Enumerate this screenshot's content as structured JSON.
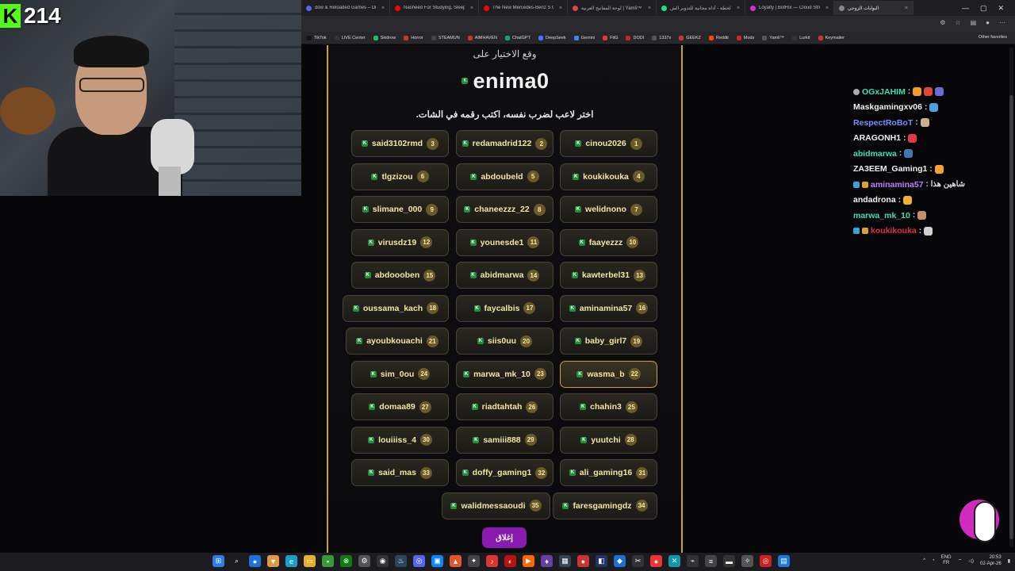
{
  "browser": {
    "tabs": [
      {
        "label": "dow & Reloaded Games – Dr",
        "color": "#5865f2"
      },
      {
        "label": "Nasheed For Studying, Sleep",
        "color": "#ff0000"
      },
      {
        "label": "The New Mercedes-Benz S Cl",
        "color": "#ff0000"
      },
      {
        "label": "لوحة المفاتيح العربية | Yamli™ محرر",
        "color": "#d44"
      },
      {
        "label": "تجنبوا الخطة - أداة مجانية للتدوير الش",
        "color": "#2d8"
      },
      {
        "label": "Loyalty | BotRix — Cloud Stream",
        "color": "#c3c"
      },
      {
        "label": "البوابات الزوجي",
        "color": "#888"
      }
    ],
    "window_controls": [
      "—",
      "▢",
      "✕"
    ],
    "bookmarks": [
      "TikTok",
      "LIVE Center",
      "Skidrow",
      "Horror",
      "STEAMUN",
      "AIMHAVEN",
      "ChatGPT",
      "DeepSeek",
      "Gemini",
      "FitG",
      "DODI",
      "1337x",
      "GEEKZ",
      "Reddit",
      "Mods",
      "Yamli™",
      "Lurkit",
      "Keymailer"
    ],
    "other_favorites": "Other favorites"
  },
  "webcam": {
    "viewer_count": "214",
    "platform_icon": "kick-icon"
  },
  "giveaway": {
    "selection_label": "وقع الاختيار على",
    "winner_name": "enima0",
    "instruction": "اختر لاعب لضرب نفسه، اكتب رقمه في الشات.",
    "close_label": "إغلاق",
    "players": [
      {
        "num": "1",
        "name": "cinou2026"
      },
      {
        "num": "2",
        "name": "redamadrid122"
      },
      {
        "num": "3",
        "name": "said3102rmd"
      },
      {
        "num": "4",
        "name": "koukikouka"
      },
      {
        "num": "5",
        "name": "abdoubeld"
      },
      {
        "num": "6",
        "name": "tlgzizou"
      },
      {
        "num": "7",
        "name": "welidnono"
      },
      {
        "num": "8",
        "name": "chaneezzz_22"
      },
      {
        "num": "9",
        "name": "slimane_000"
      },
      {
        "num": "10",
        "name": "faayezzz"
      },
      {
        "num": "11",
        "name": "younesde1"
      },
      {
        "num": "12",
        "name": "virusdz19"
      },
      {
        "num": "13",
        "name": "kawterbel31"
      },
      {
        "num": "14",
        "name": "abidmarwa"
      },
      {
        "num": "15",
        "name": "abdoooben"
      },
      {
        "num": "16",
        "name": "aminamina57"
      },
      {
        "num": "17",
        "name": "faycalbis"
      },
      {
        "num": "18",
        "name": "oussama_kach"
      },
      {
        "num": "19",
        "name": "baby_girl7"
      },
      {
        "num": "20",
        "name": "siis0uu"
      },
      {
        "num": "21",
        "name": "ayoubkouachi"
      },
      {
        "num": "22",
        "name": "wasma_b"
      },
      {
        "num": "23",
        "name": "marwa_mk_10"
      },
      {
        "num": "24",
        "name": "sim_0ou"
      },
      {
        "num": "25",
        "name": "chahin3"
      },
      {
        "num": "26",
        "name": "riadtahtah"
      },
      {
        "num": "27",
        "name": "domaa89"
      },
      {
        "num": "28",
        "name": "yuutchi"
      },
      {
        "num": "29",
        "name": "samiii888"
      },
      {
        "num": "30",
        "name": "louiiiss_4"
      },
      {
        "num": "31",
        "name": "ali_gaming16"
      },
      {
        "num": "32",
        "name": "doffy_gaming1"
      },
      {
        "num": "33",
        "name": "said_mas"
      },
      {
        "num": "34",
        "name": "faresgamingdz"
      },
      {
        "num": "35",
        "name": "walidmessaoudi"
      }
    ]
  },
  "chat": [
    {
      "user": "OGxJAHIM",
      "color": "#3ee0b0",
      "msg": ":",
      "emotes": [
        "#f59b2c",
        "#e0453a",
        "#6b6bd6"
      ]
    },
    {
      "user": "Maskgamingxv06",
      "color": "#f0f0f0",
      "msg": ":",
      "emotes": [
        "#4aa0e0"
      ]
    },
    {
      "user": "RespectRoBoT",
      "color": "#7a8cff",
      "msg": ":",
      "emotes": [
        "#c9b090"
      ]
    },
    {
      "user": "ARAGONH1",
      "color": "#f0f0f0",
      "msg": ":",
      "emotes": [
        "#e03a4a"
      ]
    },
    {
      "user": "abidmarwa",
      "color": "#3ee0b0",
      "msg": ":",
      "emotes": [
        "#3a7ab0"
      ]
    },
    {
      "user": "ZA3EEM_Gaming1",
      "color": "#f0f0f0",
      "msg": ":",
      "emotes": [
        "#f5a030"
      ]
    },
    {
      "user": "aminamina57",
      "color": "#c080ff",
      "msg": ": شاهين هذا",
      "emotes": []
    },
    {
      "user": "andadrona",
      "color": "#f0f0f0",
      "msg": ":",
      "emotes": [
        "#f0b030"
      ]
    },
    {
      "user": "marwa_mk_10",
      "color": "#3ee0b0",
      "msg": ":",
      "emotes": [
        "#c09070"
      ]
    },
    {
      "user": "koukikouka",
      "color": "#e03040",
      "msg": ":",
      "emotes": [
        "#d0d0d0"
      ]
    }
  ],
  "taskbar": {
    "lang": "ENG",
    "region": "FR",
    "time": "20:53",
    "date": "02-Apr-26"
  }
}
